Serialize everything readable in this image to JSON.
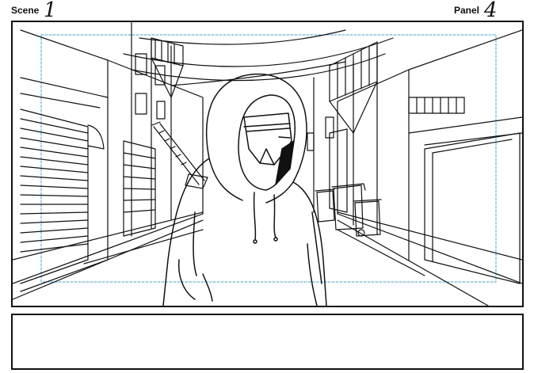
{
  "header": {
    "scene_label": "Scene",
    "scene_number": "1",
    "panel_label": "Panel",
    "panel_number": "4"
  },
  "notes": {
    "text": ""
  },
  "colors": {
    "ink": "#111111",
    "safe_area_guide": "#3aa7d8",
    "paper": "#ffffff"
  },
  "icons": {
    "sketch": "storyboard-sketch"
  }
}
